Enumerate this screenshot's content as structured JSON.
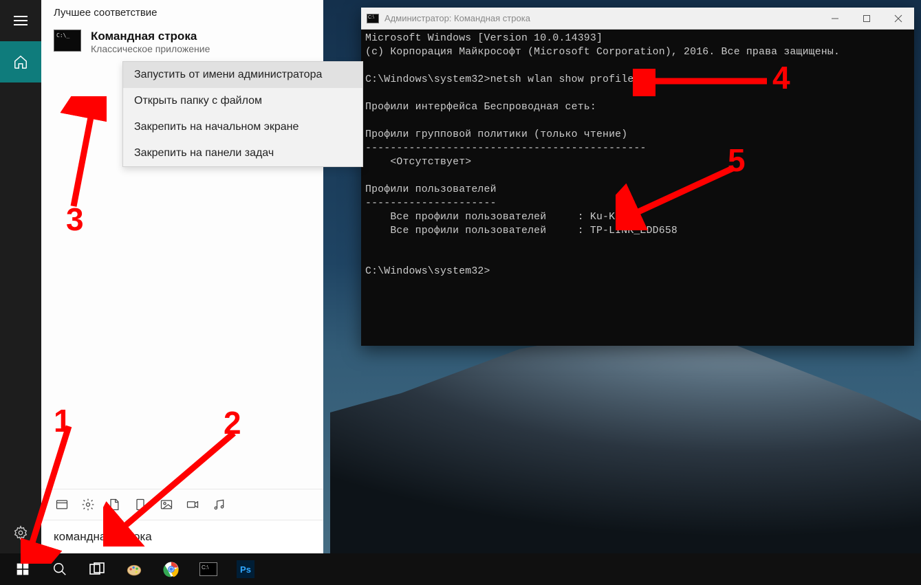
{
  "start_panel": {
    "header": "Лучшее соответствие",
    "result_title": "Командная строка",
    "result_subtitle": "Классическое приложение",
    "context_menu": [
      "Запустить от имени администратора",
      "Открыть папку с файлом",
      "Закрепить на начальном экране",
      "Закрепить на панели задач"
    ],
    "search_text": "командная строка"
  },
  "cmd_window": {
    "title": "Администратор: Командная строка",
    "lines": [
      "Microsoft Windows [Version 10.0.14393]",
      "(c) Корпорация Майкрософт (Microsoft Corporation), 2016. Все права защищены.",
      "",
      "C:\\Windows\\system32>netsh wlan show profiles",
      "",
      "Профили интерфейса Беспроводная сеть:",
      "",
      "Профили групповой политики (только чтение)",
      "---------------------------------------------",
      "    <Отсутствует>",
      "",
      "Профили пользователей",
      "---------------------",
      "    Все профили пользователей     : Ku-Ku",
      "    Все профили пользователей     : TP-LINK_EDD658",
      "",
      "",
      "C:\\Windows\\system32>"
    ]
  },
  "annotations": {
    "n1": "1",
    "n2": "2",
    "n3": "3",
    "n4": "4",
    "n5": "5"
  }
}
